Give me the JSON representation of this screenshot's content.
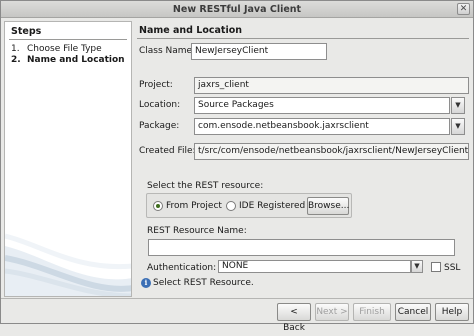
{
  "window": {
    "title": "New RESTful Java Client"
  },
  "steps": {
    "title": "Steps",
    "items": [
      {
        "num": "1.",
        "label": "Choose File Type"
      },
      {
        "num": "2.",
        "label": "Name and Location"
      }
    ]
  },
  "form": {
    "section_title": "Name and Location",
    "class_name": {
      "label": "Class Name:",
      "value": "NewJerseyClient"
    },
    "project": {
      "label": "Project:",
      "value": "jaxrs_client"
    },
    "location": {
      "label": "Location:",
      "value": "Source Packages"
    },
    "package": {
      "label": "Package:",
      "value": "com.ensode.netbeansbook.jaxrsclient"
    },
    "created_file": {
      "label": "Created File:",
      "value": "t/src/com/ensode/netbeansbook/jaxrsclient/NewJerseyClient.java"
    },
    "rest_resource": {
      "label": "Select the REST resource:",
      "from_project": "From Project",
      "ide_registered": "IDE Registered",
      "browse": "Browse...",
      "selected": "from_project"
    },
    "rest_resource_name": {
      "label": "REST Resource Name:",
      "value": ""
    },
    "authentication": {
      "label": "Authentication:",
      "value": "NONE"
    },
    "ssl": {
      "label": "SSL",
      "checked": false
    },
    "info": "Select REST Resource."
  },
  "buttons": {
    "back": "< Back",
    "next": "Next >",
    "finish": "Finish",
    "cancel": "Cancel",
    "help": "Help"
  }
}
